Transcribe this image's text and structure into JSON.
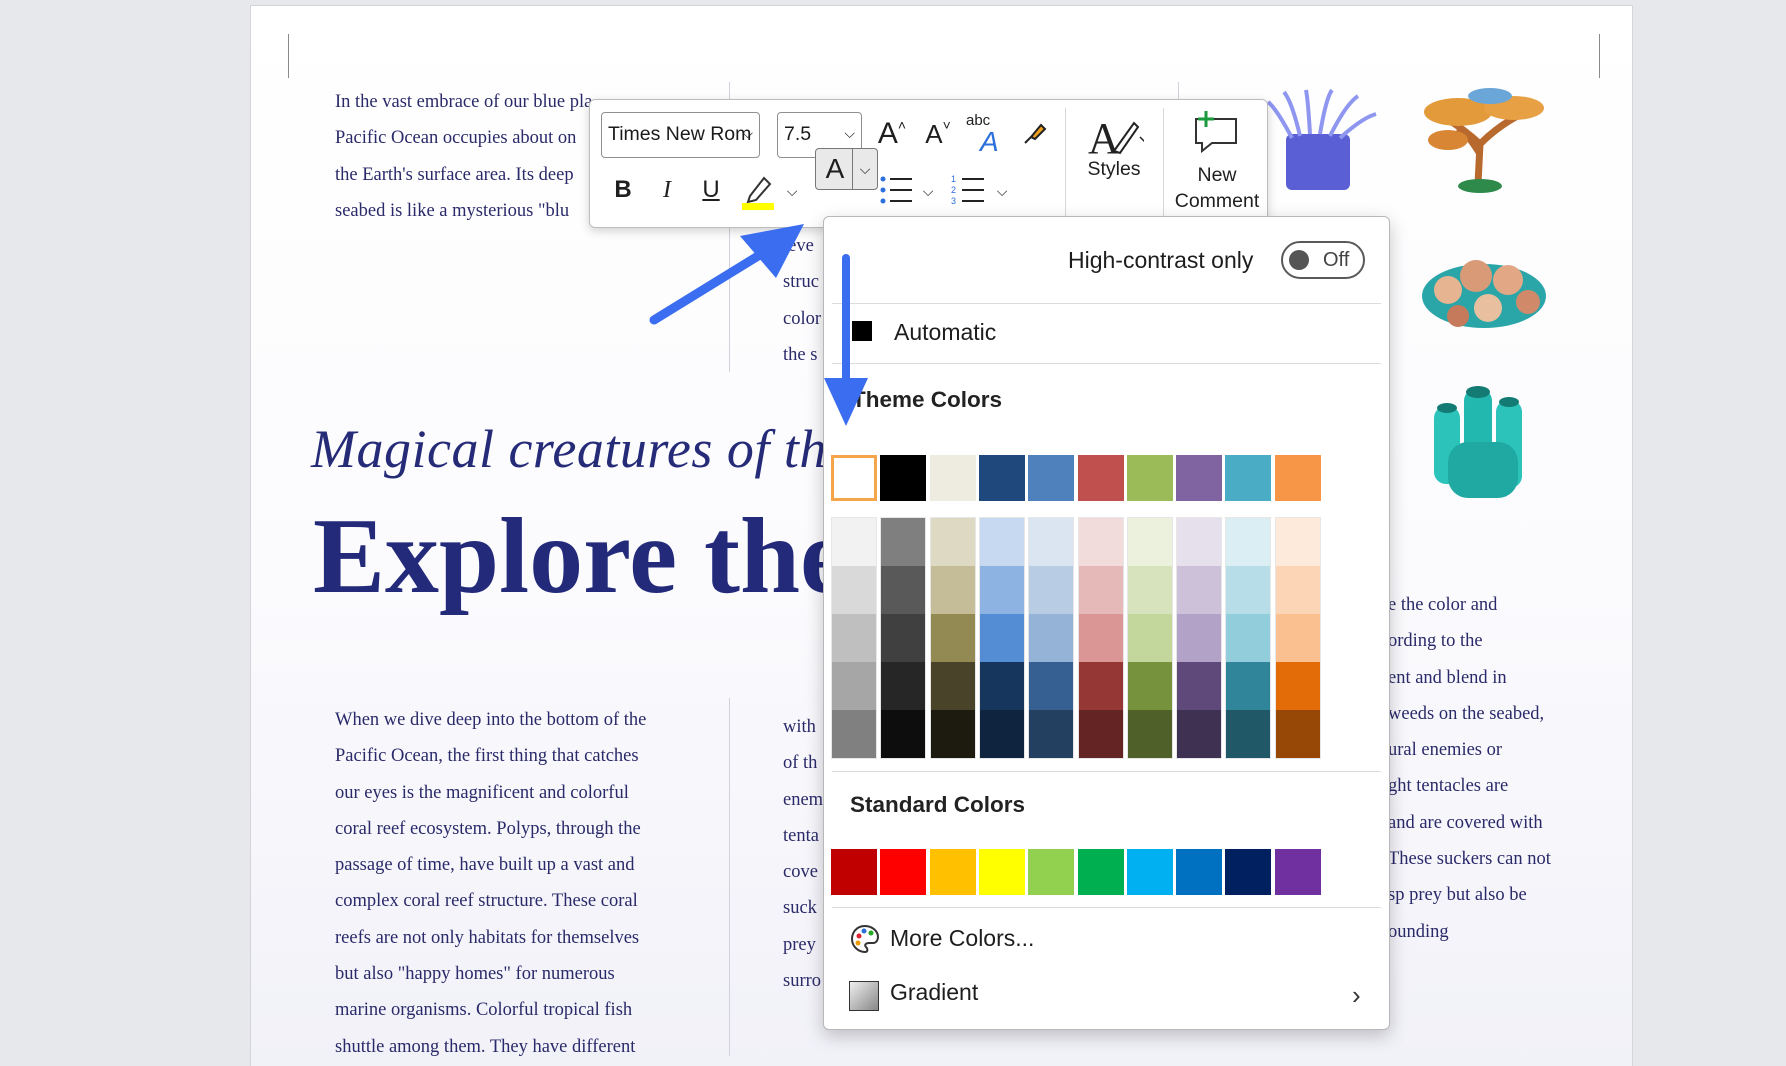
{
  "document": {
    "col1_top": [
      "In the vast embrace of our blue pla",
      "Pacific Ocean occupies about on",
      "the Earth's surface area. Its deep",
      "seabed is like a mysterious \"blu"
    ],
    "col2_top_fragments": [
      "leve",
      "struc",
      "color",
      "the s"
    ],
    "heading_italic": "Magical creatures of th",
    "heading_big": "Explore the",
    "col1_bottom": [
      "When we dive deep into the bottom of the",
      "Pacific Ocean, the first thing that catches",
      "our eyes is the magnificent and colorful",
      "coral reef ecosystem. Polyps, through the",
      "passage of time, have built up a vast and",
      "complex coral reef structure. These coral",
      "reefs are not only habitats for themselves",
      "but also \"happy homes\" for numerous",
      "marine organisms. Colorful tropical fish",
      "shuttle among them. They have different"
    ],
    "col2_bottom_fragments": [
      "with",
      "of th",
      "enem",
      "tenta",
      "cove",
      "suck",
      "prey",
      "surro"
    ],
    "col3_bottom_fragments": [
      "e the color and",
      "ording to the",
      "ent and blend in",
      "weeds on the seabed,",
      "ural enemies or",
      "ght tentacles are",
      " and are covered with",
      "These suckers can not",
      "sp prey but also be",
      "ounding"
    ]
  },
  "toolbar": {
    "font_name": "Times New Rom",
    "font_size": "7.5",
    "grow_font": "A",
    "shrink_font": "A",
    "change_case": "abc",
    "bold": "B",
    "italic": "I",
    "underline": "U",
    "font_color_glyph": "A",
    "styles_label": "Styles",
    "new_comment_line1": "New",
    "new_comment_line2": "Comment",
    "highlight_color": "#ffff00"
  },
  "color_menu": {
    "high_contrast_label": "High-contrast only",
    "toggle_state": "Off",
    "automatic_label": "Automatic",
    "theme_colors_heading": "Theme Colors",
    "standard_colors_heading": "Standard Colors",
    "more_colors_label": "More Colors...",
    "gradient_label": "Gradient",
    "theme_colors": [
      "#ffffff",
      "#000000",
      "#eeece1",
      "#1f497d",
      "#4f81bd",
      "#c0504d",
      "#9bbb59",
      "#8064a2",
      "#4bacc6",
      "#f79646"
    ],
    "selected_theme_index": 0,
    "shades": [
      [
        "#f2f2f2",
        "#d9d9d9",
        "#bfbfbf",
        "#a6a6a6",
        "#808080"
      ],
      [
        "#7f7f7f",
        "#595959",
        "#404040",
        "#262626",
        "#0d0d0d"
      ],
      [
        "#ddd9c3",
        "#c4bd97",
        "#938953",
        "#494429",
        "#1d1b10"
      ],
      [
        "#c6d9f0",
        "#8db3e2",
        "#548dd4",
        "#17365d",
        "#0f243e"
      ],
      [
        "#dbe5f1",
        "#b8cce4",
        "#95b3d7",
        "#366092",
        "#244061"
      ],
      [
        "#f2dcdb",
        "#e5b9b7",
        "#d99694",
        "#953734",
        "#632423"
      ],
      [
        "#ebf1dd",
        "#d7e3bc",
        "#c3d69b",
        "#76923c",
        "#4f6128"
      ],
      [
        "#e5e0ec",
        "#ccc1d9",
        "#b2a2c7",
        "#5f497a",
        "#3f3151"
      ],
      [
        "#dbeef3",
        "#b7dde8",
        "#92cddc",
        "#31859b",
        "#205867"
      ],
      [
        "#fdeada",
        "#fbd5b5",
        "#fac08f",
        "#e36c09",
        "#974806"
      ]
    ],
    "standard_colors": [
      "#c00000",
      "#ff0000",
      "#ffc000",
      "#ffff00",
      "#92d050",
      "#00b050",
      "#00b0f0",
      "#0070c0",
      "#002060",
      "#7030a0"
    ]
  },
  "annotations": {
    "arrow_color": "#3a6df0"
  }
}
